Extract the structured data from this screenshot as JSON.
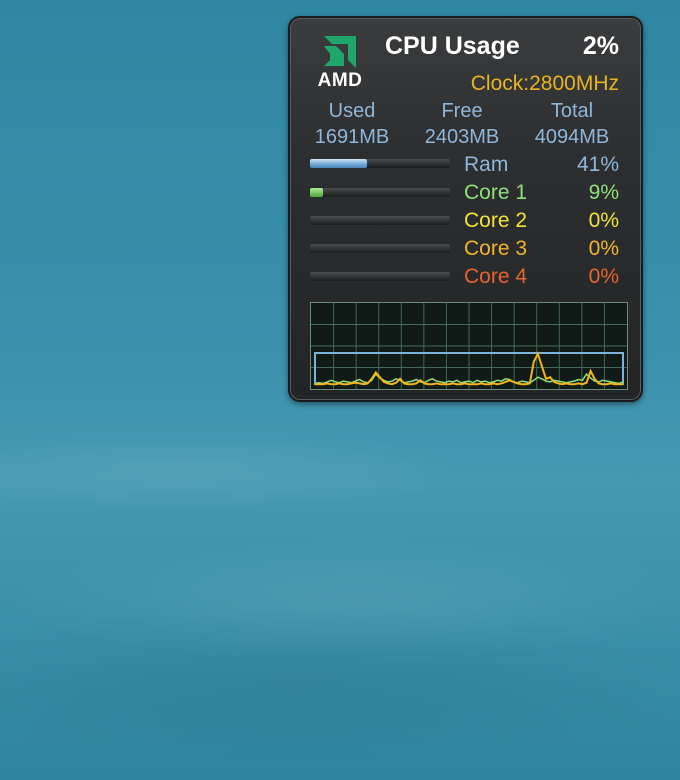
{
  "gadget": {
    "brand": "AMD",
    "title": "CPU Usage",
    "cpu_percent": "2%",
    "clock": "Clock:2800MHz",
    "memory": {
      "headers": [
        "Used",
        "Free",
        "Total"
      ],
      "values": [
        "1691MB",
        "2403MB",
        "4094MB"
      ]
    },
    "rows": [
      {
        "label": "Ram",
        "value": "41%",
        "fill": 0.41,
        "color": "#8fb6d8"
      },
      {
        "label": "Core 1",
        "value": "9%",
        "fill": 0.09,
        "color": "#8fe07a"
      },
      {
        "label": "Core 2",
        "value": "0%",
        "fill": 0.0,
        "color": "#f2e33a"
      },
      {
        "label": "Core 3",
        "value": "0%",
        "fill": 0.0,
        "color": "#f0b52e"
      },
      {
        "label": "Core 4",
        "value": "0%",
        "fill": 0.0,
        "color": "#e6642e"
      }
    ],
    "graph": {
      "ram_level": 0.41,
      "core1": [
        2,
        3,
        2,
        4,
        6,
        4,
        3,
        5,
        4,
        3,
        5,
        7,
        4,
        3,
        6,
        14,
        9,
        6,
        4,
        5,
        8,
        6,
        3,
        4,
        5,
        7,
        4,
        3,
        6,
        8,
        5,
        4,
        3,
        5,
        4,
        6,
        3,
        4,
        5,
        3,
        6,
        4,
        5,
        3,
        4,
        6,
        5,
        8,
        7,
        4,
        3,
        5,
        4,
        3,
        6,
        10,
        8,
        5,
        4,
        6,
        5,
        4,
        3,
        4,
        5,
        7,
        6,
        14,
        9,
        5,
        4,
        6,
        5,
        4,
        3,
        2,
        4
      ],
      "core2": [
        1,
        1,
        1,
        2,
        1,
        1,
        2,
        1,
        1,
        2,
        3,
        2,
        1,
        2,
        8,
        16,
        10,
        4,
        2,
        1,
        3,
        8,
        2,
        1,
        1,
        2,
        6,
        2,
        1,
        1,
        2,
        1,
        1,
        1,
        2,
        1,
        1,
        2,
        1,
        1,
        1,
        2,
        1,
        1,
        2,
        1,
        2,
        4,
        6,
        4,
        2,
        1,
        1,
        2,
        30,
        40,
        24,
        8,
        10,
        4,
        2,
        1,
        2,
        1,
        1,
        2,
        1,
        3,
        18,
        8,
        2,
        1,
        1,
        2,
        1,
        1,
        1
      ]
    },
    "colors": {
      "accent_green": "#1ea66b",
      "ram_line": "#7fb0d6",
      "core1_line": "#8fe07a",
      "core2_line": "#f2b51c"
    }
  }
}
